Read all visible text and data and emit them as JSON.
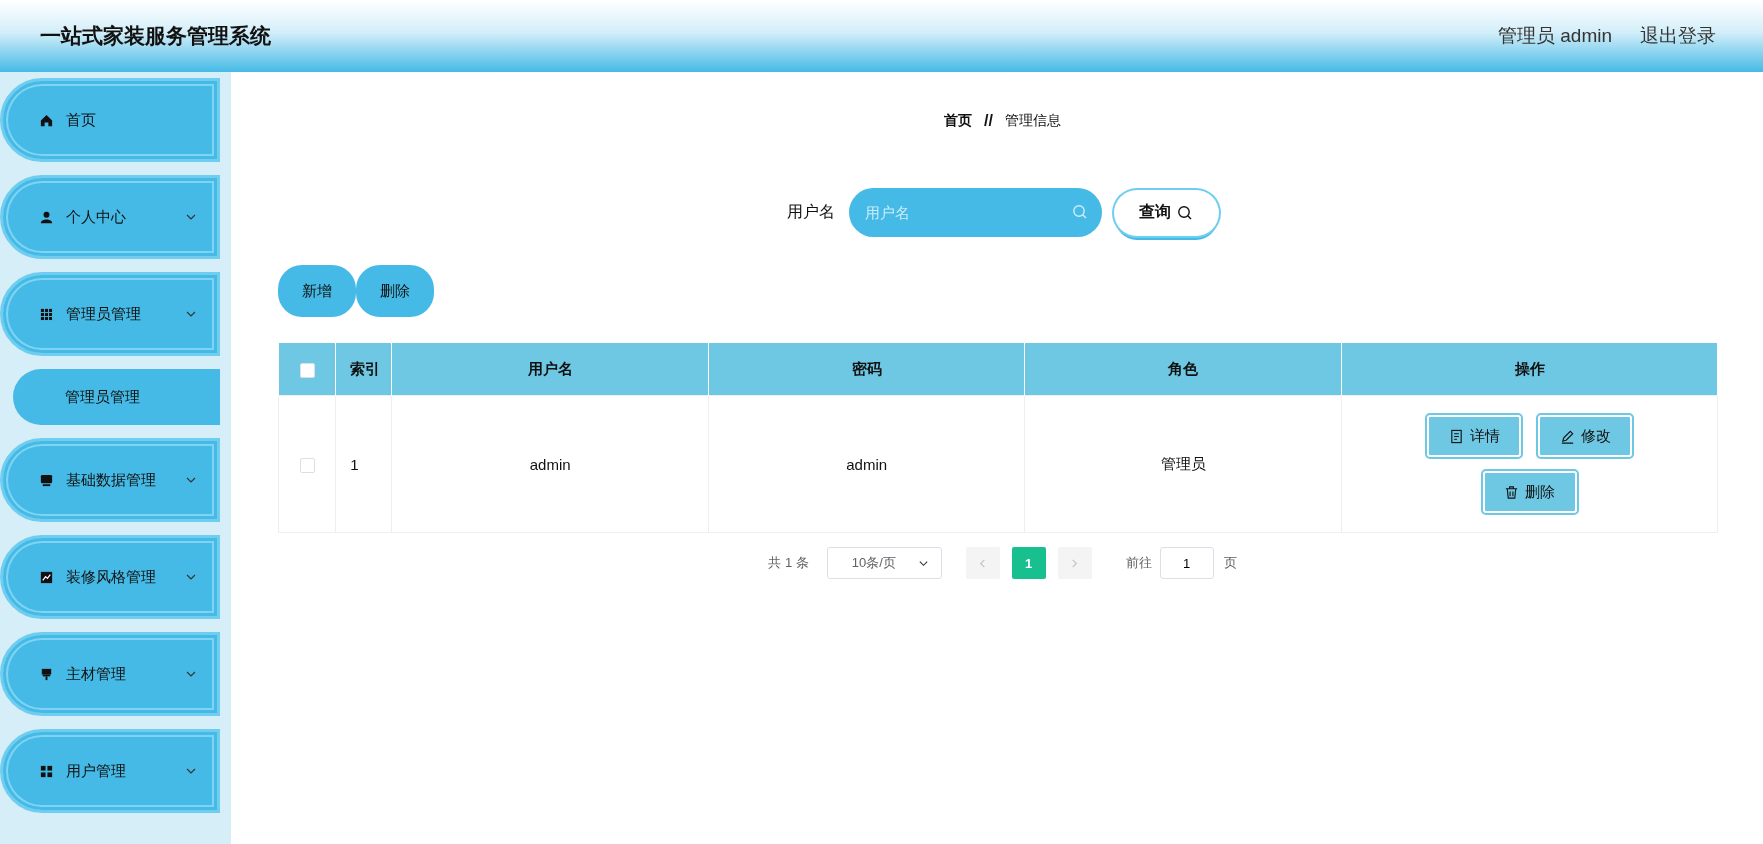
{
  "header": {
    "title": "一站式家装服务管理系统",
    "user": "管理员 admin",
    "logout": "退出登录"
  },
  "sidebar": {
    "items": [
      {
        "label": "首页",
        "expandable": false
      },
      {
        "label": "个人中心",
        "expandable": true
      },
      {
        "label": "管理员管理",
        "expandable": true,
        "children": [
          {
            "label": "管理员管理"
          }
        ]
      },
      {
        "label": "基础数据管理",
        "expandable": true
      },
      {
        "label": "装修风格管理",
        "expandable": true
      },
      {
        "label": "主材管理",
        "expandable": true
      },
      {
        "label": "用户管理",
        "expandable": true
      }
    ]
  },
  "breadcrumb": {
    "home": "首页",
    "separator": "//",
    "current": "管理信息"
  },
  "search": {
    "label": "用户名",
    "placeholder": "用户名",
    "button": "查询"
  },
  "actions": [
    "新增",
    "删除"
  ],
  "table": {
    "header_checked": false,
    "columns": [
      "索引",
      "用户名",
      "密码",
      "角色",
      "操作"
    ],
    "rows": [
      {
        "checked": false,
        "cells": [
          "1",
          "admin",
          "admin",
          "管理员"
        ],
        "operations": [
          "详情",
          "修改",
          "删除"
        ]
      }
    ]
  },
  "pagination": {
    "total": "共 1 条",
    "page_size": "10条/页",
    "pages": [
      {
        "label": "1",
        "selected": true
      }
    ],
    "goto_label": "前往",
    "goto_value": "1",
    "goto_suffix": "页"
  }
}
